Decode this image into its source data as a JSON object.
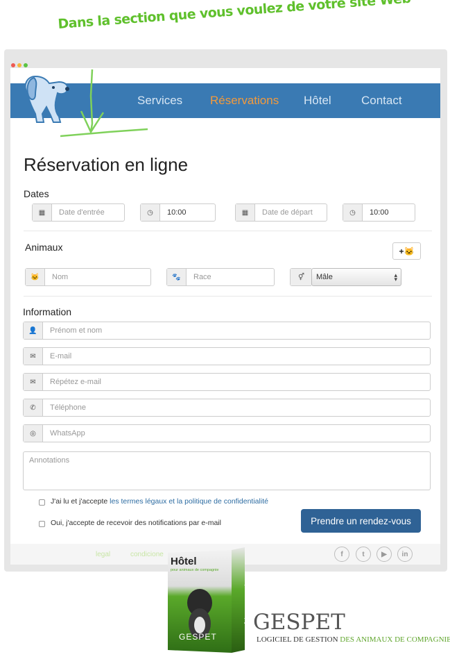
{
  "headline": "Dans la section que vous voulez de votre site Web",
  "colors": {
    "nav_bg": "#3a7ab3",
    "nav_active": "#f39a3c",
    "nav_text": "#d7e6f4",
    "button": "#2f6295",
    "accent_green": "#5fc02c"
  },
  "window_dots": [
    "#ee5a52",
    "#f5b73c",
    "#5bc443"
  ],
  "nav": {
    "items": [
      {
        "label": "Services",
        "active": false
      },
      {
        "label": "Réservations",
        "active": true
      },
      {
        "label": "Hôtel",
        "active": false
      },
      {
        "label": "Contact",
        "active": false
      }
    ]
  },
  "form": {
    "title": "Réservation en ligne",
    "dates": {
      "heading": "Dates",
      "entry_placeholder": "Date d'entrée",
      "entry_time": "10:00",
      "exit_placeholder": "Date de départ",
      "exit_time": "10:00"
    },
    "animals": {
      "heading": "Animaux",
      "add_button": "+🐱",
      "name_placeholder": "Nom",
      "breed_placeholder": "Race",
      "sex_selected": "Mâle"
    },
    "information": {
      "heading": "Information",
      "fullname_placeholder": "Prénom et nom",
      "email_placeholder": "E-mail",
      "email_repeat_placeholder": "Répétez e-mail",
      "phone_placeholder": "Téléphone",
      "whatsapp_placeholder": "WhatsApp",
      "notes_placeholder": "Annotations"
    },
    "consent": {
      "terms_prefix": "J'ai lu et j'accepte ",
      "terms_link": "les termes légaux et la politique de confidentialité",
      "notifications": "Oui, j'accepte de recevoir des notifications par e-mail"
    },
    "submit": "Prendre un rendez-vous"
  },
  "footer": {
    "links": [
      "legal",
      "condicione"
    ],
    "social": [
      "f",
      "t",
      "▶",
      "in"
    ]
  },
  "product": {
    "box_title": "Hôtel",
    "box_subtitle": "pour animaux de compagnie",
    "box_brand": "GESPET",
    "box_spine": "Hôtel pour animaux de compagnie",
    "brand": "GESPET",
    "tagline_prefix": "LOGICIEL DE GESTION ",
    "tagline_suffix": "DES ANIMAUX DE COMPAGNIE"
  }
}
